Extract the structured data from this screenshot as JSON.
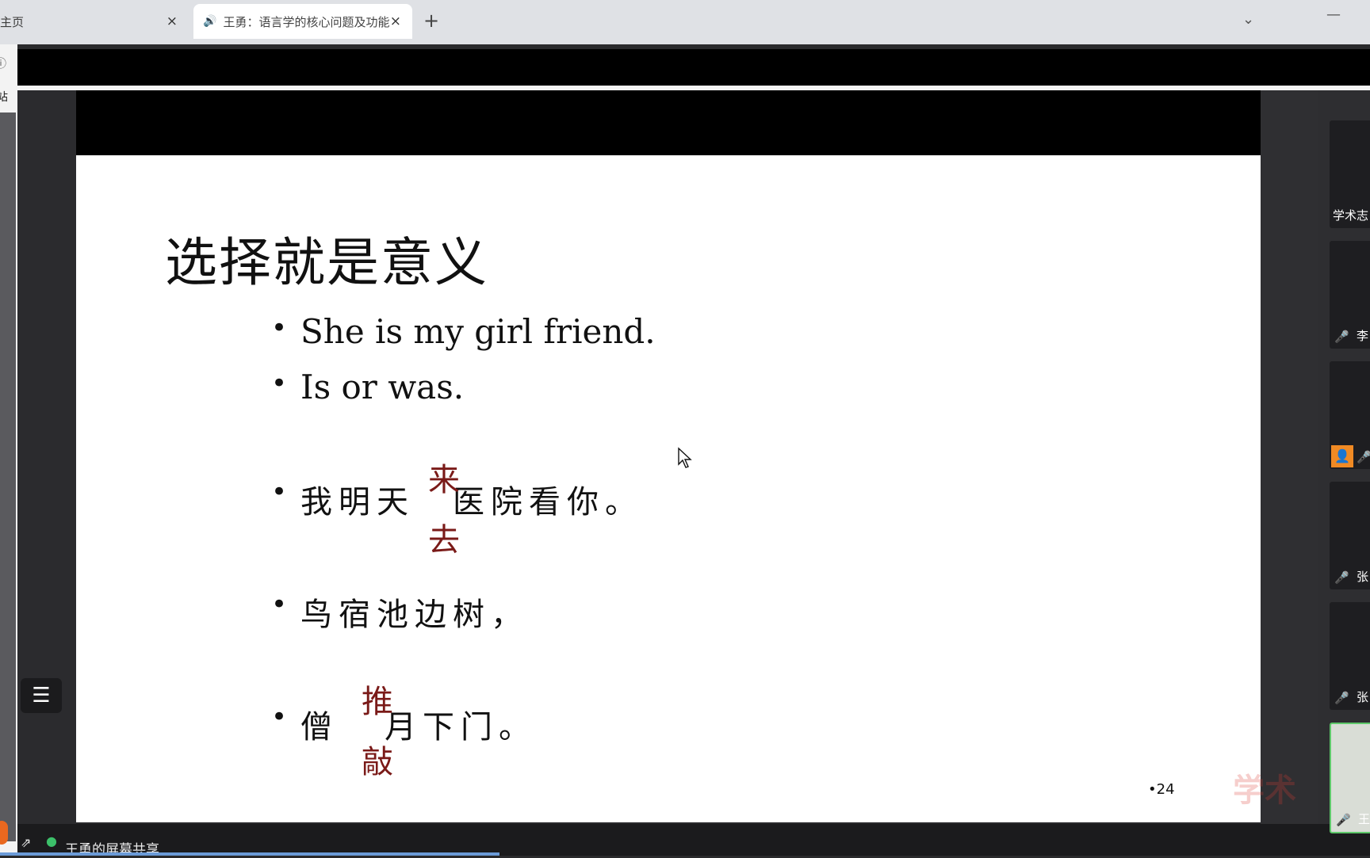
{
  "browser": {
    "tabs": [
      {
        "label": "主页",
        "close": "×"
      },
      {
        "label": "王勇：语言学的核心问题及功能",
        "close": "×"
      }
    ],
    "new_tab": "+",
    "left_strip_text": "站"
  },
  "slide": {
    "title": "选择就是意义",
    "bullets": [
      {
        "text": "She is my girl friend."
      },
      {
        "text": "Is or was."
      },
      {
        "before": "我明天",
        "after": "医院看你。",
        "choices": [
          "来",
          "去"
        ]
      },
      {
        "text": "鸟宿池边树，"
      },
      {
        "before": "僧",
        "after": "月下门。",
        "choices": [
          "推",
          "敲"
        ]
      }
    ],
    "page_number": "•24",
    "choice_color": "#7a1a18"
  },
  "meeting": {
    "share_label": "王勇的屏幕共享",
    "participants": [
      {
        "name": "学术志"
      },
      {
        "name": "李",
        "muted": true
      },
      {
        "name": "",
        "muted": true,
        "avatar": true
      },
      {
        "name": "张",
        "muted": true
      },
      {
        "name": "张",
        "muted": true
      },
      {
        "name": "王",
        "speaking": true
      }
    ],
    "watermark": "学术"
  }
}
